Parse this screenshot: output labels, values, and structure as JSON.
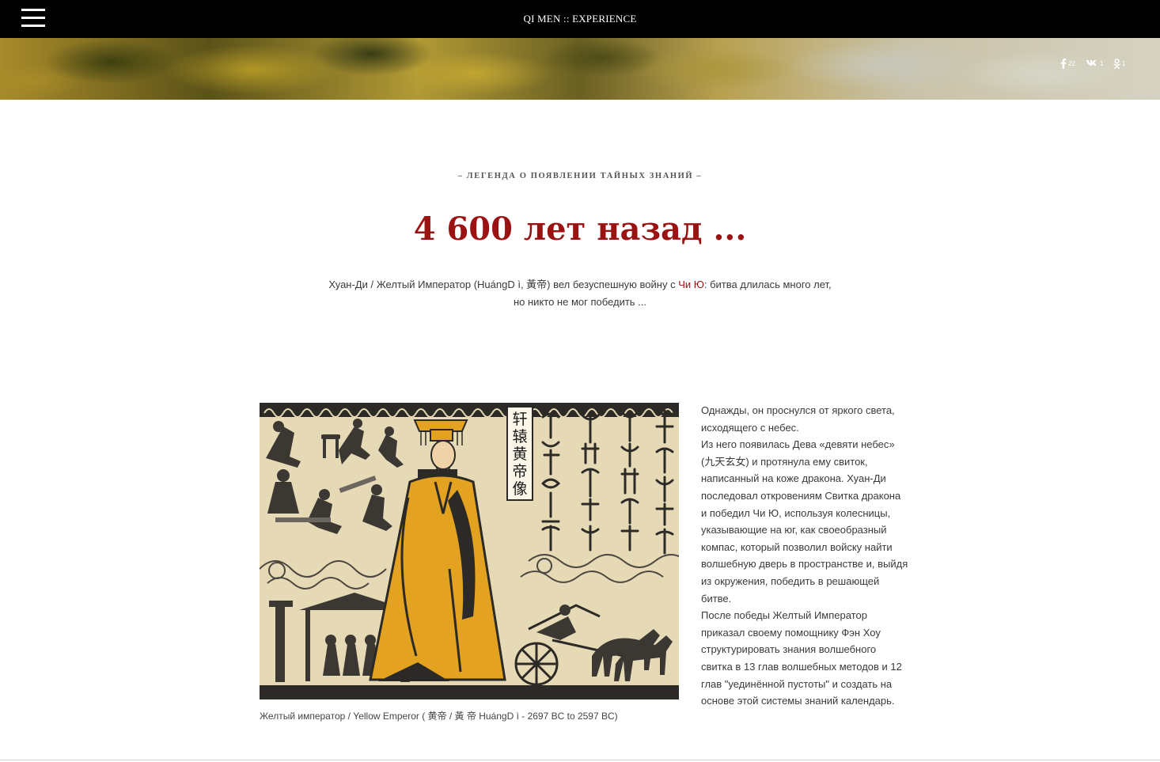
{
  "header": {
    "title": "QI MEN :: EXPERIENCE",
    "menu_icon": "hamburger-menu-icon"
  },
  "social": [
    {
      "network": "facebook",
      "icon": "facebook-icon",
      "count": "22"
    },
    {
      "network": "vk",
      "icon": "vk-icon",
      "count": "1"
    },
    {
      "network": "odnoklassniki",
      "icon": "odnoklassniki-icon",
      "count": "1"
    }
  ],
  "intro": {
    "kicker": "– ЛЕГЕНДА О ПОЯВЛЕНИИ ТАЙНЫХ ЗНАНИЙ –",
    "headline": "4 600 лет назад ...",
    "lead_before_link": "Хуан-Ди / Желтый Император (HuángD ì, 黃帝) вел безуспешную войну с ",
    "lead_link": "Чи Ю",
    "lead_after_link": ": битва длилась много лет,",
    "lead_line2": "но никто не мог победить ..."
  },
  "figure": {
    "label_vertical": [
      "轩",
      "辕",
      "黄",
      "帝",
      "像"
    ],
    "caption": "Желтый император / Yellow Emperor ( 黄帝 / 黃 帝 HuángD ì - 2697 BC to 2597 BC)"
  },
  "story": {
    "p1": "Однажды, он проснулся от яркого света, исходящего с небес.",
    "p2": "Из него появилась Дева «девяти небес» (九天玄女) и протянула ему свиток, написанный на коже дракона. Хуан-Ди последовал откровениям Свитка дракона и победил Чи Ю, используя колесницы, указывающие на юг, как своеобразный компас, который позволил войску найти волшебную дверь в пространстве и, выйдя из окружения, победить в решающей битве.",
    "p3": "После победы Желтый Император приказал своему помощнику Фэн Хоу структурировать знания волшебного свитка в 13 глав волшебных методов и 12 глав \"уединённой пустоты\" и создать на основе этой системы знаний календарь."
  },
  "colors": {
    "accent": "#9b1212",
    "topbar": "#000000",
    "robe": "#e3a21f",
    "paper": "#e6d9b6"
  }
}
